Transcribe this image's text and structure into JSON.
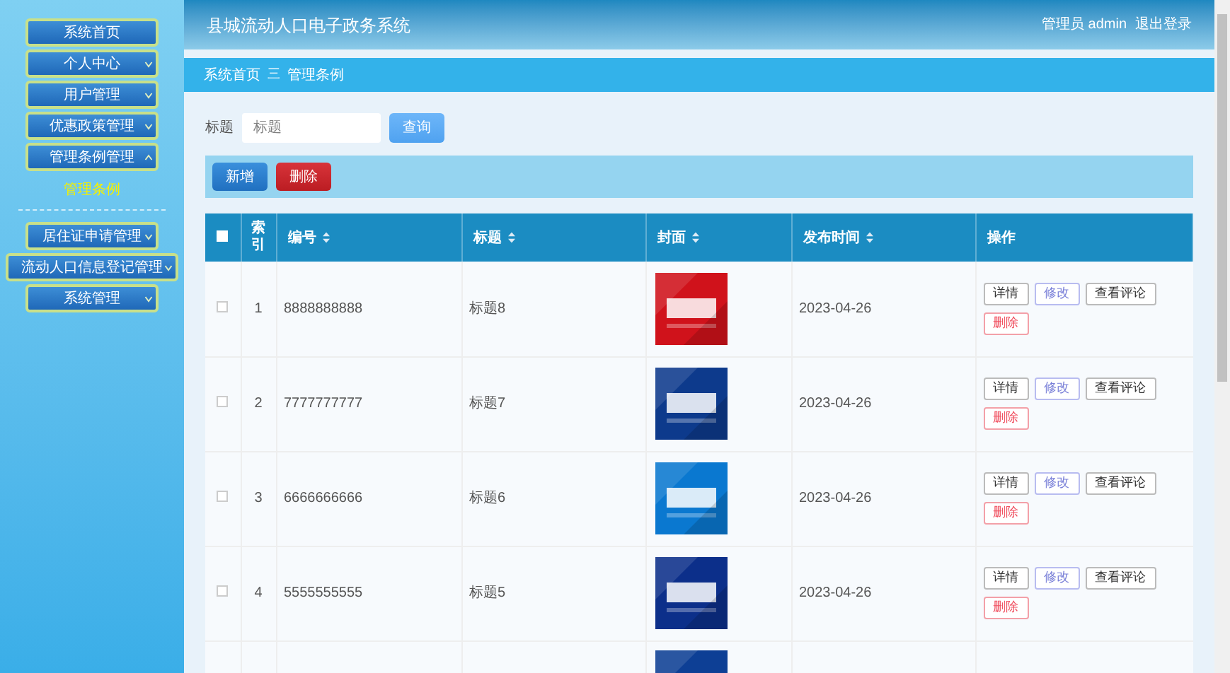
{
  "sidebar": {
    "items": [
      {
        "label": "系统首页",
        "kind": "link"
      },
      {
        "label": "个人中心",
        "kind": "menu",
        "expanded": false
      },
      {
        "label": "用户管理",
        "kind": "menu",
        "expanded": false
      },
      {
        "label": "优惠政策管理",
        "kind": "menu",
        "expanded": false
      },
      {
        "label": "管理条例管理",
        "kind": "menu",
        "expanded": true,
        "children": [
          {
            "label": "管理条例",
            "selected": true
          }
        ]
      },
      {
        "label": "居住证申请管理",
        "kind": "menu",
        "expanded": false
      },
      {
        "label": "流动人口信息登记管理",
        "kind": "menu",
        "expanded": false
      },
      {
        "label": "系统管理",
        "kind": "menu",
        "expanded": false
      }
    ]
  },
  "header": {
    "title": "县城流动人口电子政务系统",
    "user": "管理员 admin",
    "logout": "退出登录"
  },
  "breadcrumb": [
    "系统首页",
    "管理条例"
  ],
  "breadcrumb_separator": "三",
  "search": {
    "label": "标题",
    "placeholder": "标题",
    "button": "查询"
  },
  "actions": [
    {
      "label": "新增",
      "kind": "primary"
    },
    {
      "label": "删除",
      "kind": "danger"
    }
  ],
  "table": {
    "select_all": {
      "checked": false
    },
    "columns": [
      {
        "label": "索引",
        "sortable": false
      },
      {
        "label": "编号",
        "sortable": true
      },
      {
        "label": "标题",
        "sortable": true
      },
      {
        "label": "封面",
        "sortable": true
      },
      {
        "label": "发布时间",
        "sortable": true
      },
      {
        "label": "操作",
        "sortable": false
      }
    ],
    "rows": [
      {
        "checked": false,
        "index": "1",
        "number": "8888888888",
        "title": "标题8",
        "cover": {
          "kind": "picture"
        },
        "date": "2023-04-26",
        "buttons": [
          "详情",
          "修改",
          "查看评论",
          "删除"
        ]
      },
      {
        "checked": false,
        "index": "2",
        "number": "7777777777",
        "title": "标题7",
        "cover": {
          "kind": "picture"
        },
        "date": "2023-04-26",
        "buttons": [
          "详情",
          "修改",
          "查看评论",
          "删除"
        ]
      },
      {
        "checked": false,
        "index": "3",
        "number": "6666666666",
        "title": "标题6",
        "cover": {
          "kind": "picture"
        },
        "date": "2023-04-26",
        "buttons": [
          "详情",
          "修改",
          "查看评论",
          "删除"
        ]
      },
      {
        "checked": false,
        "index": "4",
        "number": "5555555555",
        "title": "标题5",
        "cover": {
          "kind": "picture"
        },
        "date": "2023-04-26",
        "buttons": [
          "详情",
          "修改",
          "查看评论",
          "删除"
        ]
      },
      {
        "cover": {
          "kind": "picture"
        }
      }
    ]
  }
}
